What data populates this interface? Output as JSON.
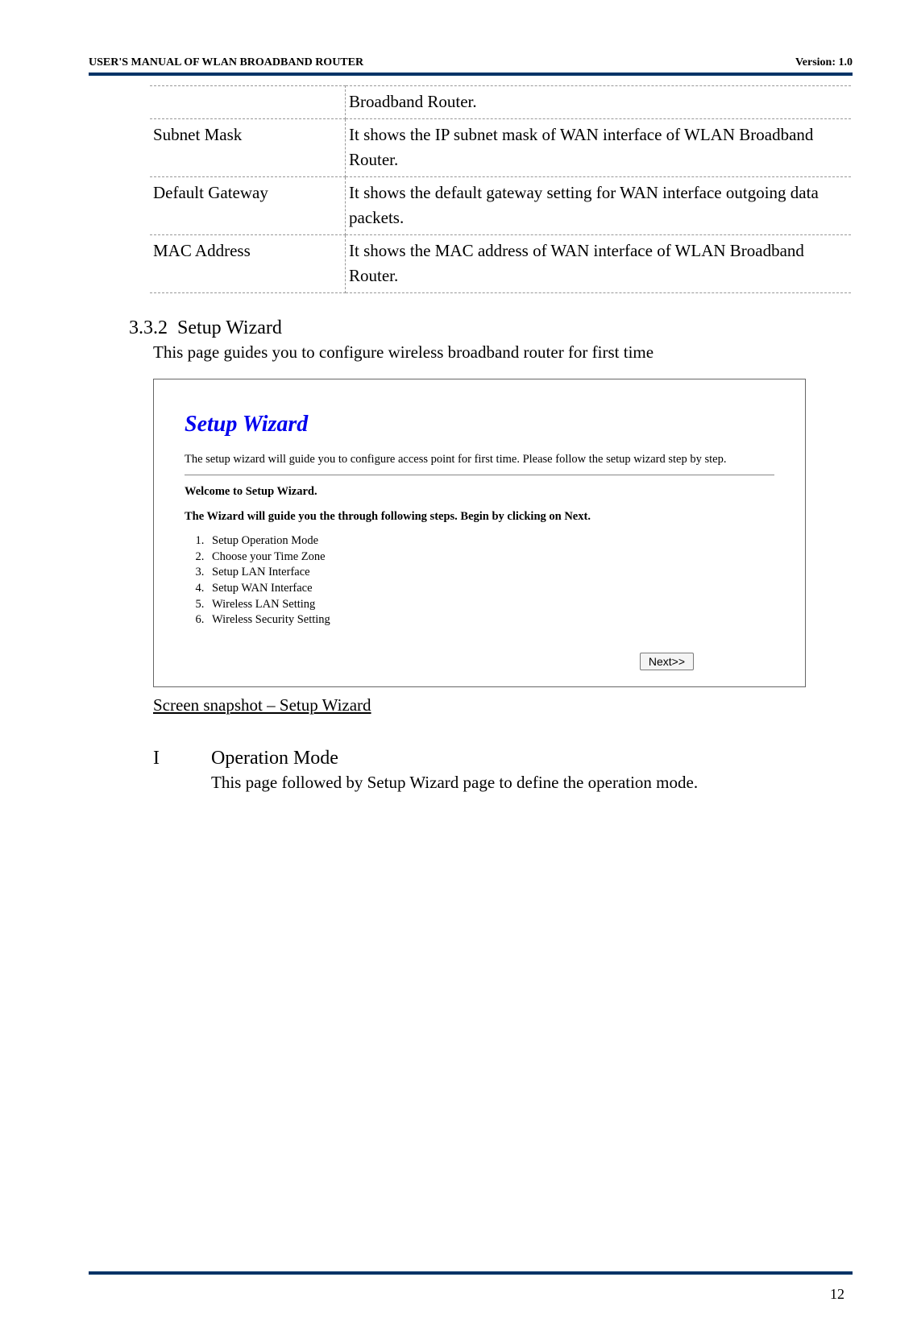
{
  "header": {
    "left": "USER'S MANUAL OF WLAN BROADBAND ROUTER",
    "right": "Version: 1.0"
  },
  "page_number": "12",
  "table": {
    "rows": [
      {
        "label": "",
        "desc": "Broadband Router."
      },
      {
        "label": "Subnet Mask",
        "desc": "It shows the IP subnet mask of WAN interface of WLAN Broadband Router."
      },
      {
        "label": "Default Gateway",
        "desc": "It shows the default gateway setting for WAN interface outgoing data packets."
      },
      {
        "label": "MAC Address",
        "desc": "It shows the MAC address of WAN interface of WLAN Broadband Router."
      }
    ]
  },
  "section": {
    "number": "3.3.2",
    "title": "Setup Wizard",
    "intro": "This page guides you to configure wireless broadband router for first time"
  },
  "wizard": {
    "title": "Setup Wizard",
    "desc": "The setup wizard will guide you to configure access point for first time. Please follow the setup wizard step by step.",
    "welcome": "Welcome to Setup Wizard.",
    "instruct": "The Wizard will guide you the through following steps. Begin by clicking on Next.",
    "steps": [
      "Setup Operation Mode",
      "Choose your Time Zone",
      "Setup LAN Interface",
      "Setup WAN Interface",
      "Wireless LAN Setting",
      "Wireless Security Setting"
    ],
    "next_label": "Next>>"
  },
  "caption": "Screen snapshot – Setup Wizard",
  "sub": {
    "num": "I",
    "title": "Operation Mode",
    "intro": "This page followed by Setup Wizard page to define the operation mode."
  }
}
